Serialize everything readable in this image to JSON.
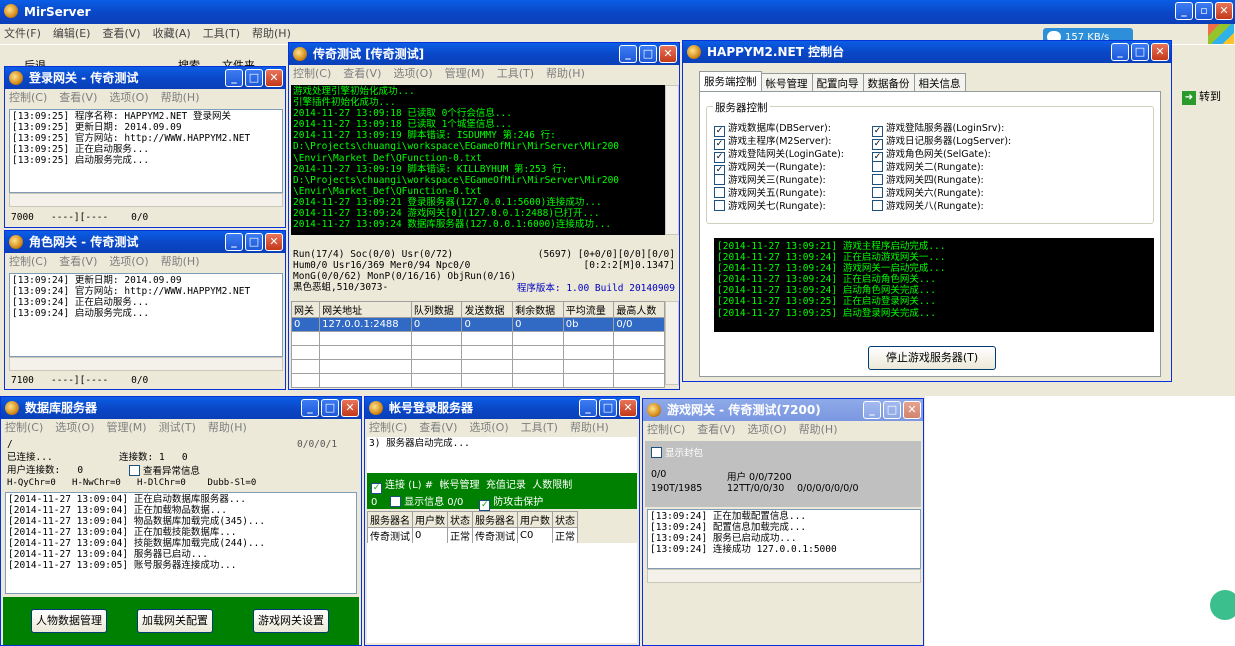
{
  "main": {
    "title": "MirServer",
    "menu": [
      "文件(F)",
      "编辑(E)",
      "查看(V)",
      "收藏(A)",
      "工具(T)",
      "帮助(H)"
    ],
    "toolbar": {
      "back": "后退",
      "search": "搜索",
      "folders": "文件夹",
      "go": "转到"
    },
    "netspeed": "157 KB/s"
  },
  "login": {
    "title": "登录网关 - 传奇测试",
    "menu": [
      "控制(C)",
      "查看(V)",
      "选项(O)",
      "帮助(H)"
    ],
    "log": "[13:09:25] 程序名称: HAPPYM2.NET 登录网关\n[13:09:25] 更新日期: 2014.09.09\n[13:09:25] 官方网站: http://WWW.HAPPYM2.NET\n[13:09:25] 正在启动服务...\n[13:09:25] 启动服务完成...",
    "status": "7000   ----][----    0/0"
  },
  "role": {
    "title": "角色网关 - 传奇测试",
    "menu": [
      "控制(C)",
      "查看(V)",
      "选项(O)",
      "帮助(H)"
    ],
    "log": "[13:09:24] 更新日期: 2014.09.09\n[13:09:24] 官方网站: http://WWW.HAPPYM2.NET\n[13:09:24] 正在启动服务...\n[13:09:24] 启动服务完成...",
    "status": "7100   ----][----    0/0"
  },
  "m2": {
    "title": "传奇测试 [传奇测试]",
    "menu": [
      "控制(C)",
      "查看(V)",
      "选项(O)",
      "管理(M)",
      "工具(T)",
      "帮助(H)"
    ],
    "console": "游戏处理引擎初始化成功...\n引擎插件初始化成功...\n2014-11-27 13:09:18 已读取 0个行会信息...\n2014-11-27 13:09:18 已读取 1个城堡信息...\n2014-11-27 13:09:19 脚本错误: ISDUMMY 第:246 行:\nD:\\Projects\\chuangi\\workspace\\EGameOfMir\\MirServer\\Mir200\n\\Envir\\Market_Def\\QFunction-0.txt\n2014-11-27 13:09:19 脚本错误: KILLBYHUM 第:253 行:\nD:\\Projects\\chuangi\\workspace\\EGameOfMir\\MirServer\\Mir200\n\\Envir\\Market_Def\\QFunction-0.txt\n2014-11-27 13:09:21 登录服务器(127.0.0.1:5600)连接成功...\n2014-11-27 13:09:24 游戏网关[0](127.0.0.1:2488)已打开...\n2014-11-27 13:09:24 数据库服务器(127.0.0.1:6000)连接成功...",
    "stat1": "Run(17/4) Soc(0/0) Usr(0/72)",
    "stat1r": "(5697) [0+0/0][0/0][0/0]",
    "stat2": "Hum0/0 Usr16/369 Mer0/94 Npc0/0",
    "stat2r": "[0:2:2[M]0.1347]",
    "stat3": "MonG(0/0/62) MonP(0/16/16) ObjRun(0/16)",
    "stat4": "黑色恶蛆,510/3073-",
    "version": "程序版本: 1.00 Build 20140909",
    "cols": [
      "网关",
      "网关地址",
      "队列数据",
      "发送数据",
      "剩余数据",
      "平均流量",
      "最高人数"
    ],
    "row": [
      "0",
      "127.0.0.1:2488",
      "0",
      "0",
      "0",
      "0b",
      "0/0"
    ]
  },
  "ctrl": {
    "title": "HAPPYM2.NET 控制台",
    "tabs": [
      "服务端控制",
      "帐号管理",
      "配置向导",
      "数据备份",
      "相关信息"
    ],
    "group": "服务器控制",
    "left": [
      [
        "游戏数据库(DBServer):",
        true
      ],
      [
        "游戏主程序(M2Server):",
        true
      ],
      [
        "游戏登陆网关(LoginGate):",
        true
      ],
      [
        "游戏网关一(Rungate):",
        true
      ],
      [
        "游戏网关三(Rungate):",
        false
      ],
      [
        "游戏网关五(Rungate):",
        false
      ],
      [
        "游戏网关七(Rungate):",
        false
      ]
    ],
    "right": [
      [
        "游戏登陆服务器(LoginSrv):",
        true
      ],
      [
        "游戏日记服务器(LogServer):",
        true
      ],
      [
        "游戏角色网关(SelGate):",
        true
      ],
      [
        "游戏网关二(Rungate):",
        false
      ],
      [
        "游戏网关四(Rungate):",
        false
      ],
      [
        "游戏网关六(Rungate):",
        false
      ],
      [
        "游戏网关八(Rungate):",
        false
      ]
    ],
    "console": "[2014-11-27 13:09:21] 游戏主程序启动完成...\n[2014-11-27 13:09:24] 正在启动游戏网关一...\n[2014-11-27 13:09:24] 游戏网关一启动完成...\n[2014-11-27 13:09:24] 正在启动角色网关...\n[2014-11-27 13:09:24] 启动角色网关完成...\n[2014-11-27 13:09:25] 正在启动登录网关...\n[2014-11-27 13:09:25] 启动登录网关完成...",
    "stop": "停止游戏服务器(T)"
  },
  "db": {
    "title": "数据库服务器",
    "menu": [
      "控制(C)",
      "选项(O)",
      "管理(M)",
      "测试(T)",
      "帮助(H)"
    ],
    "slash": "/",
    "ratio": "0/0/0/1",
    "conn": "已连接...",
    "conncount": "连接数: 1   0",
    "userconn": "用户连接数:   0",
    "abnormal": "查看异常信息",
    "stats": "H-QyChr=0   H-NwChr=0   H-DlChr=0    Dubb-Sl=0",
    "log": "[2014-11-27 13:09:04] 正在启动数据库服务器...\n[2014-11-27 13:09:04] 正在加载物品数据...\n[2014-11-27 13:09:04] 物品数据库加载完成(345)...\n[2014-11-27 13:09:04] 正在加载技能数据库...\n[2014-11-27 13:09:04] 技能数据库加载完成(244)...\n[2014-11-27 13:09:04] 服务器已启动...\n[2014-11-27 13:09:05] 账号服务器连接成功...",
    "buttons": [
      "人物数据管理",
      "加载网关配置",
      "游戏网关设置"
    ]
  },
  "acc": {
    "title": "帐号登录服务器",
    "menu": [
      "控制(C)",
      "查看(V)",
      "选项(O)",
      "工具(T)",
      "帮助(H)"
    ],
    "log": "3) 服务器启动完成...",
    "bar": [
      "连接 (L)",
      "#",
      "帐号管理",
      "充值记录",
      "人数限制"
    ],
    "bar2": [
      "0",
      "显示信息  0/0",
      "防攻击保护"
    ],
    "cols": [
      "服务器名",
      "用户数",
      "状态",
      "服务器名",
      "用户数",
      "状态"
    ],
    "row": [
      "传奇测试",
      "0",
      "正常",
      "传奇测试",
      "C0",
      "正常"
    ]
  },
  "game": {
    "title": "游戏网关 - 传奇测试(7200)",
    "menu": [
      "控制(C)",
      "查看(V)",
      "选项(O)",
      "帮助(H)"
    ],
    "showpkg": "显示封包",
    "r1a": "0/0",
    "r1b": "用户 0/0/7200",
    "r2a": "190T/1985",
    "r2b": "12TT/0/0/30",
    "r2c": "0/0/0/0/0/0/0",
    "log": "[13:09:24] 正在加载配置信息...\n[13:09:24] 配置信息加载完成...\n[13:09:24] 服务已启动成功...\n[13:09:24] 连接成功 127.0.0.1:5000"
  }
}
